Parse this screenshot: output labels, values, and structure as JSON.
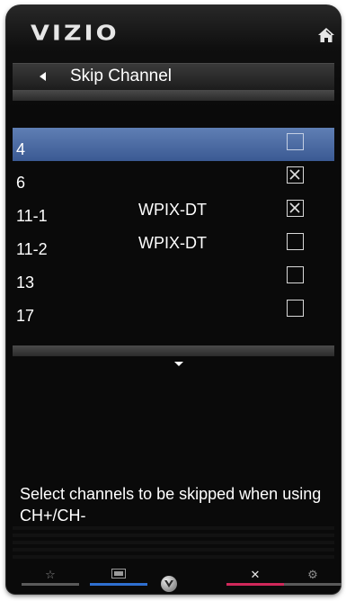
{
  "brand": {
    "logo": "VIZIO"
  },
  "header": {
    "title": "Skip Channel"
  },
  "channels": [
    {
      "number": "4",
      "name": "",
      "skipped": false,
      "selected": true
    },
    {
      "number": "6",
      "name": "",
      "skipped": true,
      "selected": false
    },
    {
      "number": "11-1",
      "name": "WPIX-DT",
      "skipped": true,
      "selected": false
    },
    {
      "number": "11-2",
      "name": "WPIX-DT",
      "skipped": false,
      "selected": false
    },
    {
      "number": "13",
      "name": "",
      "skipped": false,
      "selected": false
    },
    {
      "number": "17",
      "name": "",
      "skipped": false,
      "selected": false
    }
  ],
  "help": {
    "text": "Select channels to be skipped when using CH+/CH-"
  },
  "icons": {
    "home": "home-icon",
    "back": "back-arrow-icon",
    "scroll": "chevron-down-icon",
    "checkbox_checked": "x-mark-icon"
  },
  "bottom_bar": [
    {
      "icon": "star-icon",
      "accent": "#5a5a5a"
    },
    {
      "icon": "screen-icon",
      "accent": "#2f6fd0"
    },
    {
      "icon": "vizio-v-icon",
      "accent": "#000000"
    },
    {
      "icon": "close-icon",
      "accent": "#d0285a"
    },
    {
      "icon": "gear-icon",
      "accent": "#5a5a5a"
    }
  ],
  "colors": {
    "selected_row": "#4a6aa3",
    "background": "#0a0a0a",
    "text": "#ffffff"
  }
}
